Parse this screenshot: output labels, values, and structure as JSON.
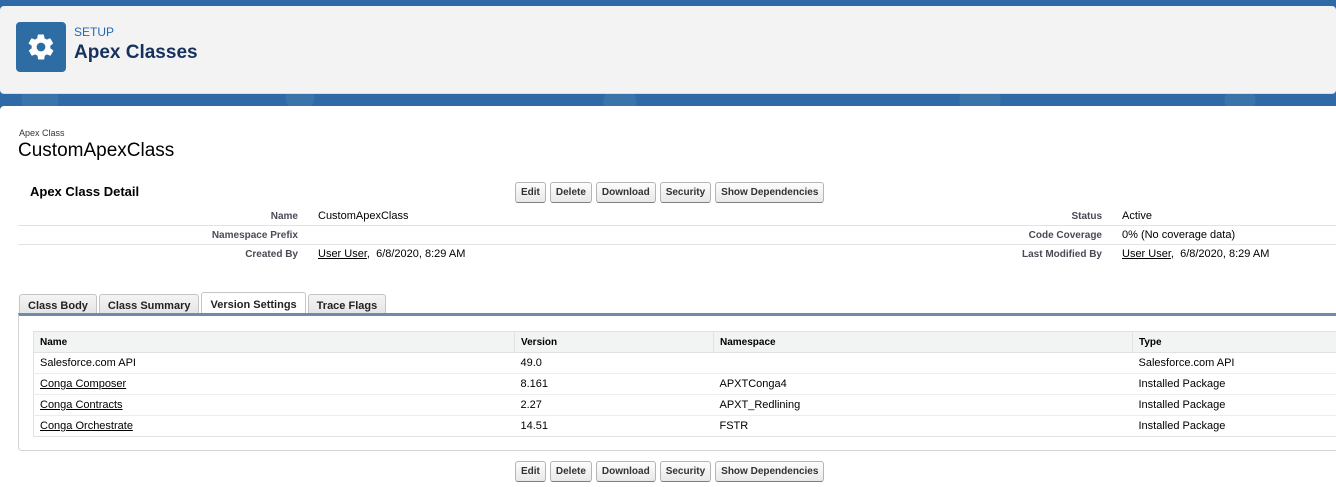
{
  "header": {
    "eyebrow": "SETUP",
    "title": "Apex Classes",
    "icon": "gear-icon"
  },
  "record": {
    "type_label": "Apex Class",
    "name": "CustomApexClass"
  },
  "detail": {
    "section_title": "Apex Class Detail",
    "fields_left": [
      {
        "label": "Name",
        "value": "CustomApexClass"
      },
      {
        "label": "Namespace Prefix",
        "value": ""
      },
      {
        "label": "Created By",
        "link": "User User",
        "value": ",  6/8/2020, 8:29 AM"
      }
    ],
    "fields_right": [
      {
        "label": "Status",
        "value": "Active"
      },
      {
        "label": "Code Coverage",
        "value": "0% (No coverage data)"
      },
      {
        "label": "Last Modified By",
        "link": "User User",
        "value": ",  6/8/2020, 8:29 AM"
      }
    ]
  },
  "buttons": {
    "edit": "Edit",
    "delete": "Delete",
    "download": "Download",
    "security": "Security",
    "dependencies": "Show Dependencies"
  },
  "tabs": [
    {
      "label": "Class Body",
      "active": false
    },
    {
      "label": "Class Summary",
      "active": false
    },
    {
      "label": "Version Settings",
      "active": true
    },
    {
      "label": "Trace Flags",
      "active": false
    }
  ],
  "version_table": {
    "columns": [
      "Name",
      "Version",
      "Namespace",
      "Type"
    ],
    "rows": [
      {
        "name": "Salesforce.com API",
        "is_link": false,
        "version": "49.0",
        "namespace": "",
        "type": "Salesforce.com API"
      },
      {
        "name": "Conga Composer",
        "is_link": true,
        "version": "8.161",
        "namespace": "APXTConga4",
        "type": "Installed Package"
      },
      {
        "name": "Conga Contracts",
        "is_link": true,
        "version": "2.27",
        "namespace": "APXT_Redlining",
        "type": "Installed Package"
      },
      {
        "name": "Conga Orchestrate",
        "is_link": true,
        "version": "14.51",
        "namespace": "FSTR",
        "type": "Installed Package"
      }
    ]
  },
  "colors": {
    "brand_blue": "#2e6ca4",
    "banner_blue": "#2f6aa6",
    "tab_underline": "#6f8bab"
  }
}
